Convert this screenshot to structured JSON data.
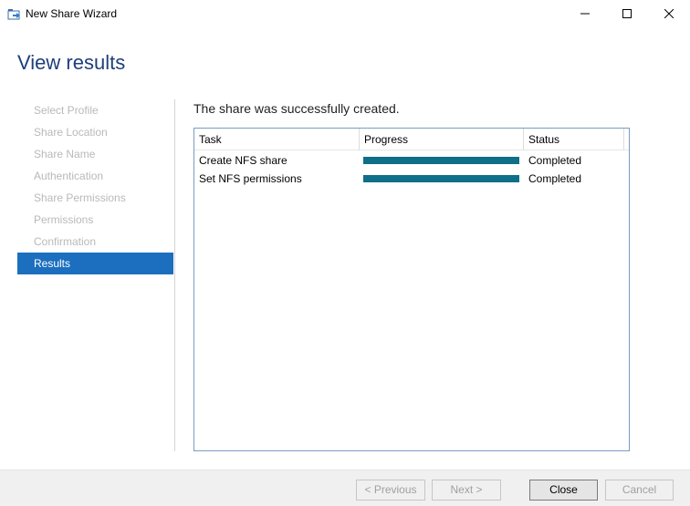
{
  "window": {
    "title": "New Share Wizard",
    "icon": "share-wizard-icon"
  },
  "page": {
    "heading": "View results",
    "message": "The share was successfully created."
  },
  "nav": {
    "items": [
      {
        "label": "Select Profile",
        "active": false
      },
      {
        "label": "Share Location",
        "active": false
      },
      {
        "label": "Share Name",
        "active": false
      },
      {
        "label": "Authentication",
        "active": false
      },
      {
        "label": "Share Permissions",
        "active": false
      },
      {
        "label": "Permissions",
        "active": false
      },
      {
        "label": "Confirmation",
        "active": false
      },
      {
        "label": "Results",
        "active": true
      }
    ]
  },
  "grid": {
    "columns": [
      "Task",
      "Progress",
      "Status"
    ],
    "rows": [
      {
        "task": "Create NFS share",
        "progress": 1.0,
        "status": "Completed"
      },
      {
        "task": "Set NFS permissions",
        "progress": 1.0,
        "status": "Completed"
      }
    ]
  },
  "buttons": {
    "previous": "< Previous",
    "next": "Next >",
    "close": "Close",
    "cancel": "Cancel"
  },
  "colors": {
    "accent": "#1c6fbf",
    "progress": "#0f6e88",
    "heading": "#1e3f7a"
  }
}
